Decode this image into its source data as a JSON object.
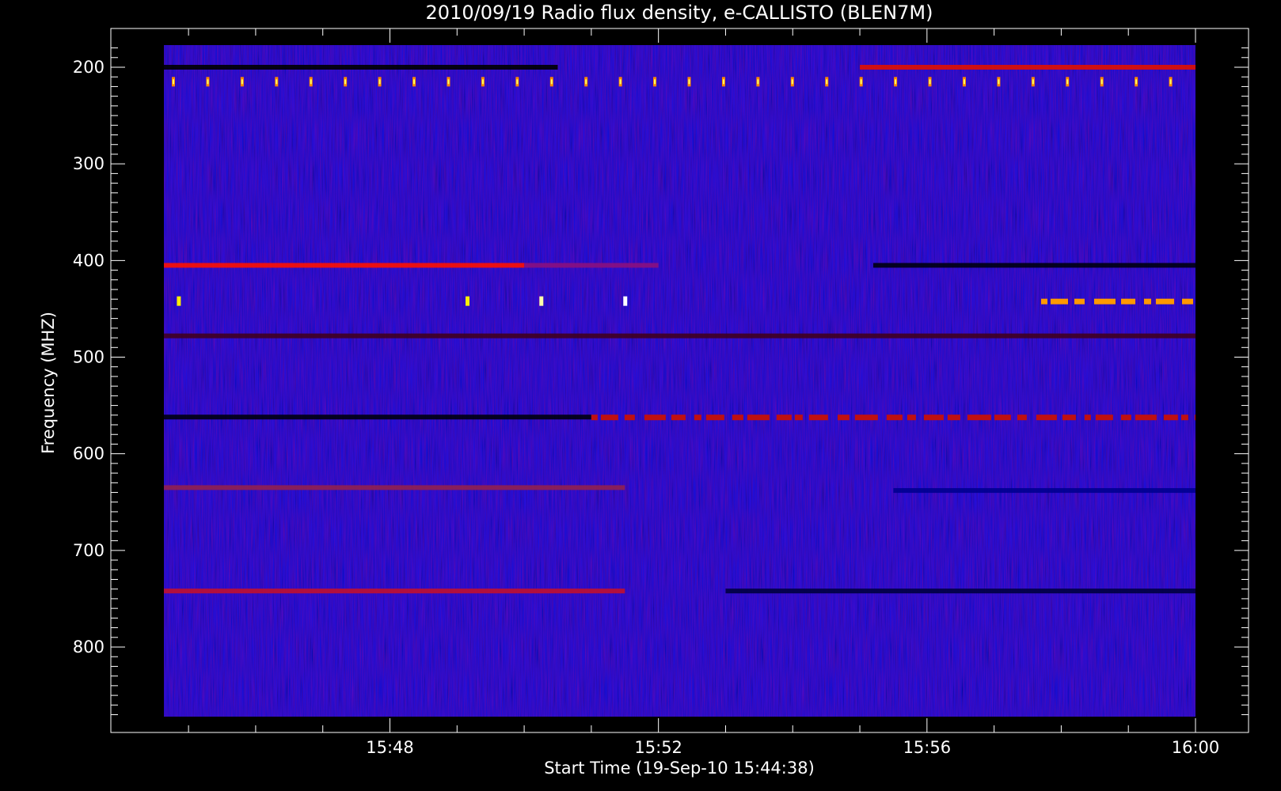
{
  "chart_data": {
    "type": "heatmap",
    "title": "2010/09/19  Radio flux density, e-CALLISTO (BLEN7M)",
    "xlabel": "Start Time (19-Sep-10 15:44:38)",
    "ylabel": "Frequency (MHZ)",
    "x_start": "15:44:38",
    "x_end": "16:00:00",
    "xlim_minutes": [
      44.633,
      60.0
    ],
    "x_ticks": [
      {
        "label": "15:48",
        "minute": 48
      },
      {
        "label": "15:52",
        "minute": 52
      },
      {
        "label": "15:56",
        "minute": 56
      },
      {
        "label": "16:00",
        "minute": 60
      }
    ],
    "x_minor_step_minutes": 1,
    "ylim_mhz": [
      870,
      180
    ],
    "y_axis_inverted": true,
    "y_ticks": [
      {
        "label": "200",
        "value": 200
      },
      {
        "label": "300",
        "value": 300
      },
      {
        "label": "400",
        "value": 400
      },
      {
        "label": "500",
        "value": 500
      },
      {
        "label": "600",
        "value": 600
      },
      {
        "label": "700",
        "value": 700
      },
      {
        "label": "800",
        "value": 800
      }
    ],
    "y_minor_step_mhz": 10,
    "colormap": [
      "#000000",
      "#0000ff",
      "#ff0000",
      "#ffff00",
      "#ffffff"
    ],
    "background_color": "#1010e6",
    "bands": [
      {
        "mhz": 200,
        "start_min": 44.633,
        "end_min": 50.5,
        "color": "#000000"
      },
      {
        "mhz": 200,
        "start_min": 55.0,
        "end_min": 60.0,
        "color": "#e01000"
      },
      {
        "mhz": 215,
        "start_min": 44.633,
        "end_min": 60.0,
        "color": "#ff8800",
        "pattern": "periodic"
      },
      {
        "mhz": 405,
        "start_min": 44.633,
        "end_min": 50.0,
        "color": "#ff1000"
      },
      {
        "mhz": 405,
        "start_min": 50.0,
        "end_min": 52.0,
        "color": "#8a1080"
      },
      {
        "mhz": 405,
        "start_min": 55.2,
        "end_min": 60.0,
        "color": "#000010"
      },
      {
        "mhz": 442,
        "start_min": 57.7,
        "end_min": 60.0,
        "color": "#ff9900",
        "pattern": "bursty"
      },
      {
        "mhz": 478,
        "start_min": 44.633,
        "end_min": 60.0,
        "color": "#400020"
      },
      {
        "mhz": 562,
        "start_min": 44.633,
        "end_min": 51.0,
        "color": "#000010"
      },
      {
        "mhz": 562,
        "start_min": 51.0,
        "end_min": 60.0,
        "color": "#c01010",
        "pattern": "intermittent"
      },
      {
        "mhz": 635,
        "start_min": 44.633,
        "end_min": 51.5,
        "color": "#902050"
      },
      {
        "mhz": 638,
        "start_min": 55.5,
        "end_min": 60.0,
        "color": "#000090"
      },
      {
        "mhz": 742,
        "start_min": 44.633,
        "end_min": 51.5,
        "color": "#c01030"
      },
      {
        "mhz": 742,
        "start_min": 53.0,
        "end_min": 60.0,
        "color": "#000040"
      }
    ],
    "spikes": [
      {
        "mhz": 442,
        "minute": 44.85,
        "color": "#ffee00"
      },
      {
        "mhz": 442,
        "minute": 49.15,
        "color": "#ffee00"
      },
      {
        "mhz": 442,
        "minute": 50.25,
        "color": "#ffffaa"
      },
      {
        "mhz": 442,
        "minute": 51.5,
        "color": "#ffffff"
      }
    ]
  }
}
